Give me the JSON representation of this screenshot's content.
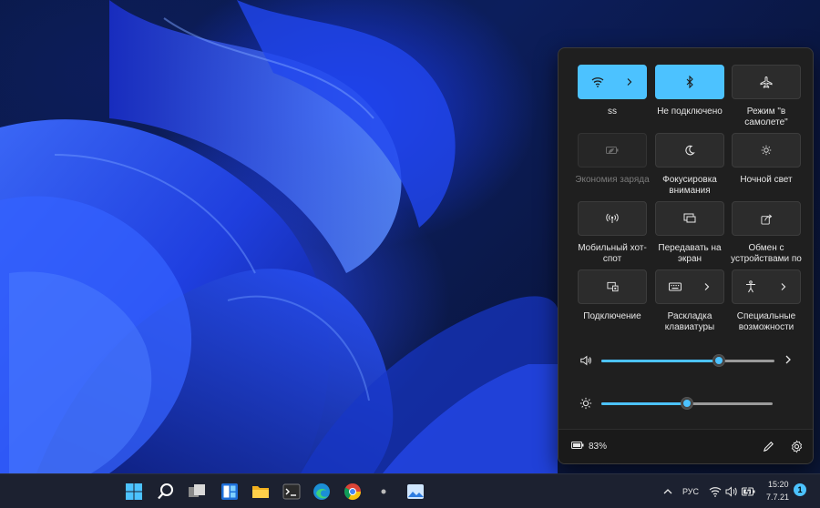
{
  "quick_settings": {
    "tiles": [
      {
        "id": "wifi",
        "label": "ss",
        "state": "on",
        "icon": "wifi-icon",
        "has_chevron": true
      },
      {
        "id": "bluetooth",
        "label": "Не подключено",
        "state": "on",
        "icon": "bluetooth-icon",
        "has_chevron": false
      },
      {
        "id": "airplane",
        "label": "Режим \"в самолете\"",
        "state": "off",
        "icon": "airplane-icon",
        "has_chevron": false
      },
      {
        "id": "battery-saver",
        "label": "Экономия заряда",
        "state": "disabled",
        "icon": "battery-saver-icon",
        "has_chevron": false
      },
      {
        "id": "focus",
        "label": "Фокусировка внимания",
        "state": "off",
        "icon": "moon-icon",
        "has_chevron": false
      },
      {
        "id": "night-light",
        "label": "Ночной свет",
        "state": "off",
        "icon": "brightness-icon",
        "has_chevron": false
      },
      {
        "id": "hotspot",
        "label": "Мобильный хот-спот",
        "state": "off",
        "icon": "hotspot-icon",
        "has_chevron": false
      },
      {
        "id": "project",
        "label": "Передавать на экран",
        "state": "off",
        "icon": "cast-icon",
        "has_chevron": false
      },
      {
        "id": "nearby-share",
        "label": "Обмен с устройствами по",
        "state": "off",
        "icon": "share-icon",
        "has_chevron": false
      },
      {
        "id": "connect",
        "label": "Подключение",
        "state": "off",
        "icon": "connect-icon",
        "has_chevron": false
      },
      {
        "id": "keyboard-layout",
        "label": "Раскладка клавиатуры",
        "state": "off",
        "icon": "keyboard-icon",
        "has_chevron": true
      },
      {
        "id": "accessibility",
        "label": "Специальные возможности",
        "state": "off",
        "icon": "accessibility-icon",
        "has_chevron": true
      }
    ],
    "volume_level": 0.68,
    "brightness_level": 0.5,
    "battery_text": "83%"
  },
  "tray": {
    "language": "РУС",
    "time": "15:20",
    "date": "7.7.21",
    "notification_count": "1"
  },
  "colors": {
    "accent": "#4cc2ff",
    "panel_bg": "#1f1f1f",
    "taskbar_bg": "#1c2130"
  }
}
